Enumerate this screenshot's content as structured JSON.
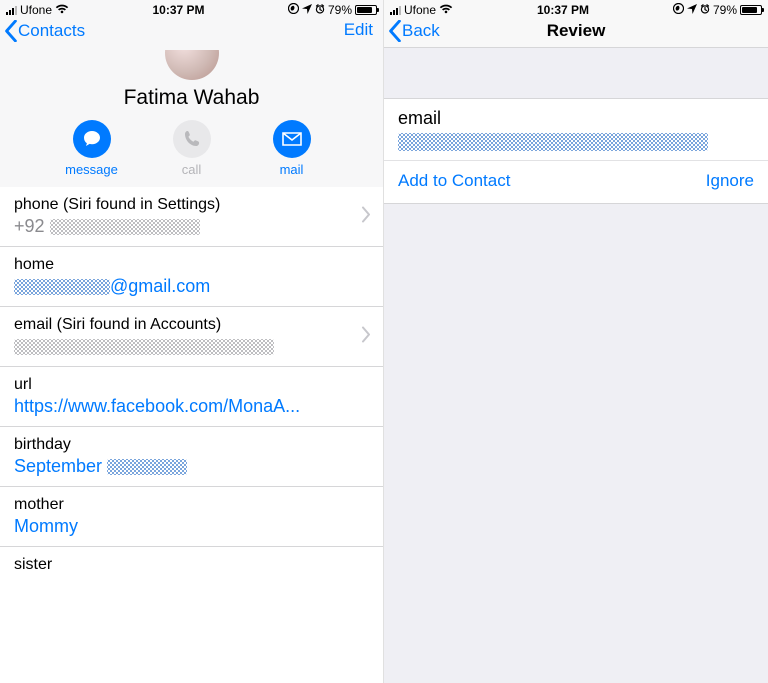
{
  "status": {
    "carrier": "Ufone",
    "time": "10:37 PM",
    "battery_pct": "79%"
  },
  "left": {
    "back_label": "Contacts",
    "edit_label": "Edit",
    "contact_name": "Fatima Wahab",
    "actions": {
      "message": "message",
      "call": "call",
      "mail": "mail"
    },
    "rows": {
      "phone": {
        "label": "phone (Siri found in Settings)",
        "prefix": "+92"
      },
      "home": {
        "label": "home",
        "suffix": "@gmail.com"
      },
      "email_siri": {
        "label": "email (Siri found in Accounts)"
      },
      "url": {
        "label": "url",
        "value": "https://www.facebook.com/MonaA..."
      },
      "birthday": {
        "label": "birthday",
        "prefix": "September "
      },
      "mother": {
        "label": "mother",
        "value": "Mommy"
      },
      "sister": {
        "label": "sister"
      }
    }
  },
  "right": {
    "back_label": "Back",
    "title": "Review",
    "email_label": "email",
    "add_label": "Add to Contact",
    "ignore_label": "Ignore"
  }
}
